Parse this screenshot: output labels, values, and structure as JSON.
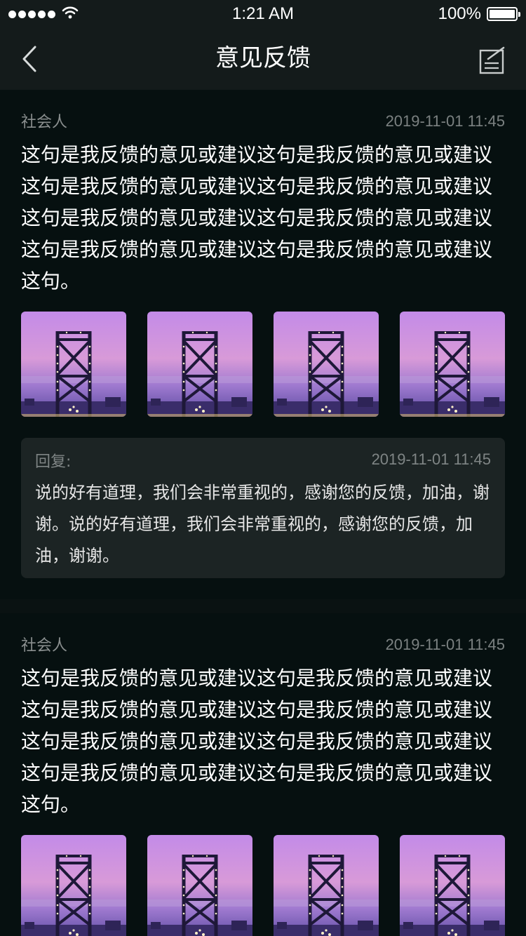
{
  "status_bar": {
    "signal_dots": 5,
    "wifi_icon": "wifi-icon",
    "time": "1:21 AM",
    "battery_percent": "100%",
    "battery_level": 1.0
  },
  "nav": {
    "back_icon": "chevron-left-icon",
    "title": "意见反馈",
    "edit_icon": "edit-note-icon"
  },
  "colors": {
    "background": "#0a1212",
    "bar": "#141b1b",
    "card": "#061010",
    "reply_bg": "#1c2424",
    "text_primary": "#ffffff",
    "text_secondary": "#8a8f8f"
  },
  "feedback": [
    {
      "author": "社会人",
      "date": "2019-11-01 11:45",
      "content": "这句是我反馈的意见或建议这句是我反馈的意见或建议这句是我反馈的意见或建议这句是我反馈的意见或建议这句是我反馈的意见或建议这句是我反馈的意见或建议这句是我反馈的意见或建议这句是我反馈的意见或建议这句。",
      "images": [
        "bridge-photo",
        "bridge-photo",
        "bridge-photo",
        "bridge-photo"
      ],
      "reply": {
        "label": "回复:",
        "date": "2019-11-01 11:45",
        "text": "说的好有道理，我们会非常重视的，感谢您的反馈，加油，谢谢。说的好有道理，我们会非常重视的，感谢您的反馈，加油，谢谢。"
      }
    },
    {
      "author": "社会人",
      "date": "2019-11-01 11:45",
      "content": "这句是我反馈的意见或建议这句是我反馈的意见或建议这句是我反馈的意见或建议这句是我反馈的意见或建议这句是我反馈的意见或建议这句是我反馈的意见或建议这句是我反馈的意见或建议这句是我反馈的意见或建议这句。",
      "images": [
        "bridge-photo",
        "bridge-photo",
        "bridge-photo",
        "bridge-photo"
      ]
    }
  ]
}
